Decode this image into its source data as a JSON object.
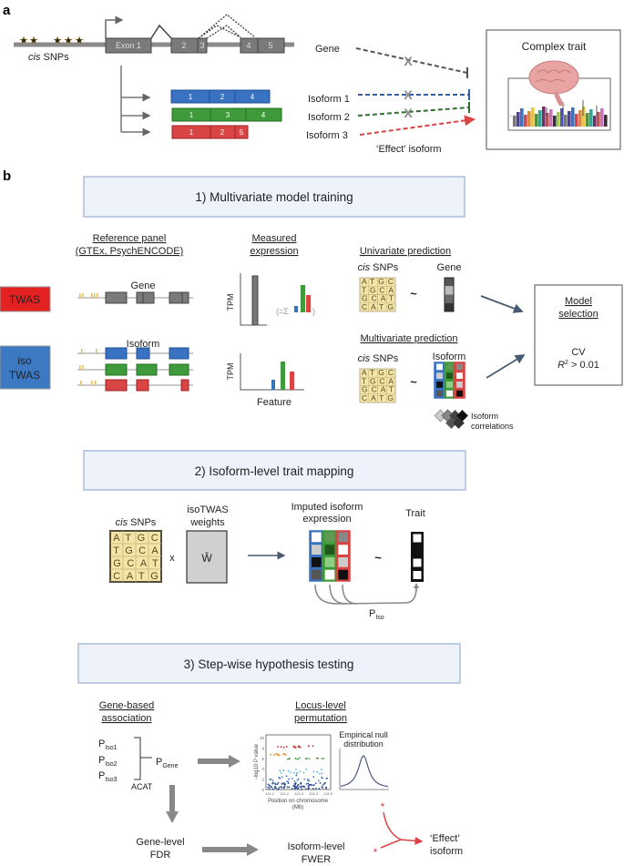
{
  "panel_labels": {
    "a": "a",
    "b": "b"
  },
  "colors": {
    "blue": "#3a72c2",
    "green": "#3e9a3a",
    "red": "#d94444",
    "twas_red": "#e52222",
    "isotwas_blue": "#3b79c3",
    "step_box_fill": "#edf2fb",
    "step_box_stroke": "#a9bddb",
    "snp_matrix_fill": "#f3e4a8",
    "gray_exon": "#7a7a7a",
    "arrow_gray": "#888888"
  },
  "panel_a": {
    "snps_italic": "cis",
    "snps_rest": " SNPs",
    "exons": [
      "Exon 1",
      "2",
      "3",
      "4",
      "5"
    ],
    "isoform_exons": [
      [
        "1",
        "2",
        "4"
      ],
      [
        "1",
        "3",
        "4"
      ],
      [
        "1",
        "2",
        "5"
      ]
    ],
    "gene_label": "Gene",
    "isoform_labels": [
      "Isoform 1",
      "Isoform 2",
      "Isoform 3"
    ],
    "blocked_marker": "X",
    "effect_label": "‘Effect’ isoform",
    "trait_title": "Complex trait"
  },
  "step1": {
    "title": "1) Multivariate model training",
    "ref_panel": [
      "Reference panel",
      "(GTEx, PsychENCODE)"
    ],
    "measured": [
      "Measured",
      "expression"
    ],
    "twas": "TWAS",
    "isotwas": [
      "iso",
      "TWAS"
    ],
    "gene_label": "Gene",
    "isoform_label": "Isoform",
    "tpm": "TPM",
    "sum_open": "(=Σ",
    "sum_close": ")",
    "feature": "Feature",
    "univariate": "Univariate prediction",
    "multivariate": "Multivariate prediction",
    "snps_italic": "cis",
    "snps_rest": " SNPs",
    "gene_col_label": "Gene",
    "isoform_col_label": "Isoform",
    "tilde": "~",
    "iso_corr": [
      "Isoform",
      "correlations"
    ],
    "model_selection": [
      "Model",
      "selection"
    ],
    "cv": "CV",
    "r2_R": "R",
    "r2_sup": "2",
    "r2_rest": " > 0.01"
  },
  "snp_matrix": [
    "ATGC",
    "TGCA",
    "GCAT",
    "CATG"
  ],
  "step2": {
    "title": "2) Isoform-level trait mapping",
    "snps_italic": "cis",
    "snps_rest": " SNPs",
    "weights": [
      "isoTWAS",
      "weights"
    ],
    "times": "x",
    "w_hat": "Ŵ",
    "imputed": [
      "Imputed isoform",
      "expression"
    ],
    "tilde": "~",
    "trait": "Trait",
    "p_iso_main": "P",
    "p_iso_sub": "Iso"
  },
  "step3": {
    "title": "3) Step-wise hypothesis testing",
    "gene_based": [
      "Gene-based",
      "association"
    ],
    "p_isos": [
      {
        "main": "P",
        "sub": "Iso1"
      },
      {
        "main": "P",
        "sub": "Iso2"
      },
      {
        "main": "P",
        "sub": "Iso3"
      }
    ],
    "p_gene_main": "P",
    "p_gene_sub": "Gene",
    "acat": "ACAT",
    "locus": [
      "Locus-level",
      "permutation"
    ],
    "locus_yaxis": "−log10 P value",
    "locus_yticks": [
      "0",
      "2",
      "4",
      "6",
      "8",
      "10"
    ],
    "locus_xticks": [
      "124.1",
      "124.2",
      "124.3",
      "124.4",
      "124.5"
    ],
    "locus_xlabel": [
      "Position on chromosome",
      "(Mb)"
    ],
    "null_dist": [
      "Empirical null",
      "distribution"
    ],
    "gene_fdr": [
      "Gene-level",
      "FDR"
    ],
    "iso_fwer": [
      "Isoform-level",
      "FWER"
    ],
    "star": "*",
    "effect": [
      "‘Effect’",
      "isoform"
    ]
  }
}
